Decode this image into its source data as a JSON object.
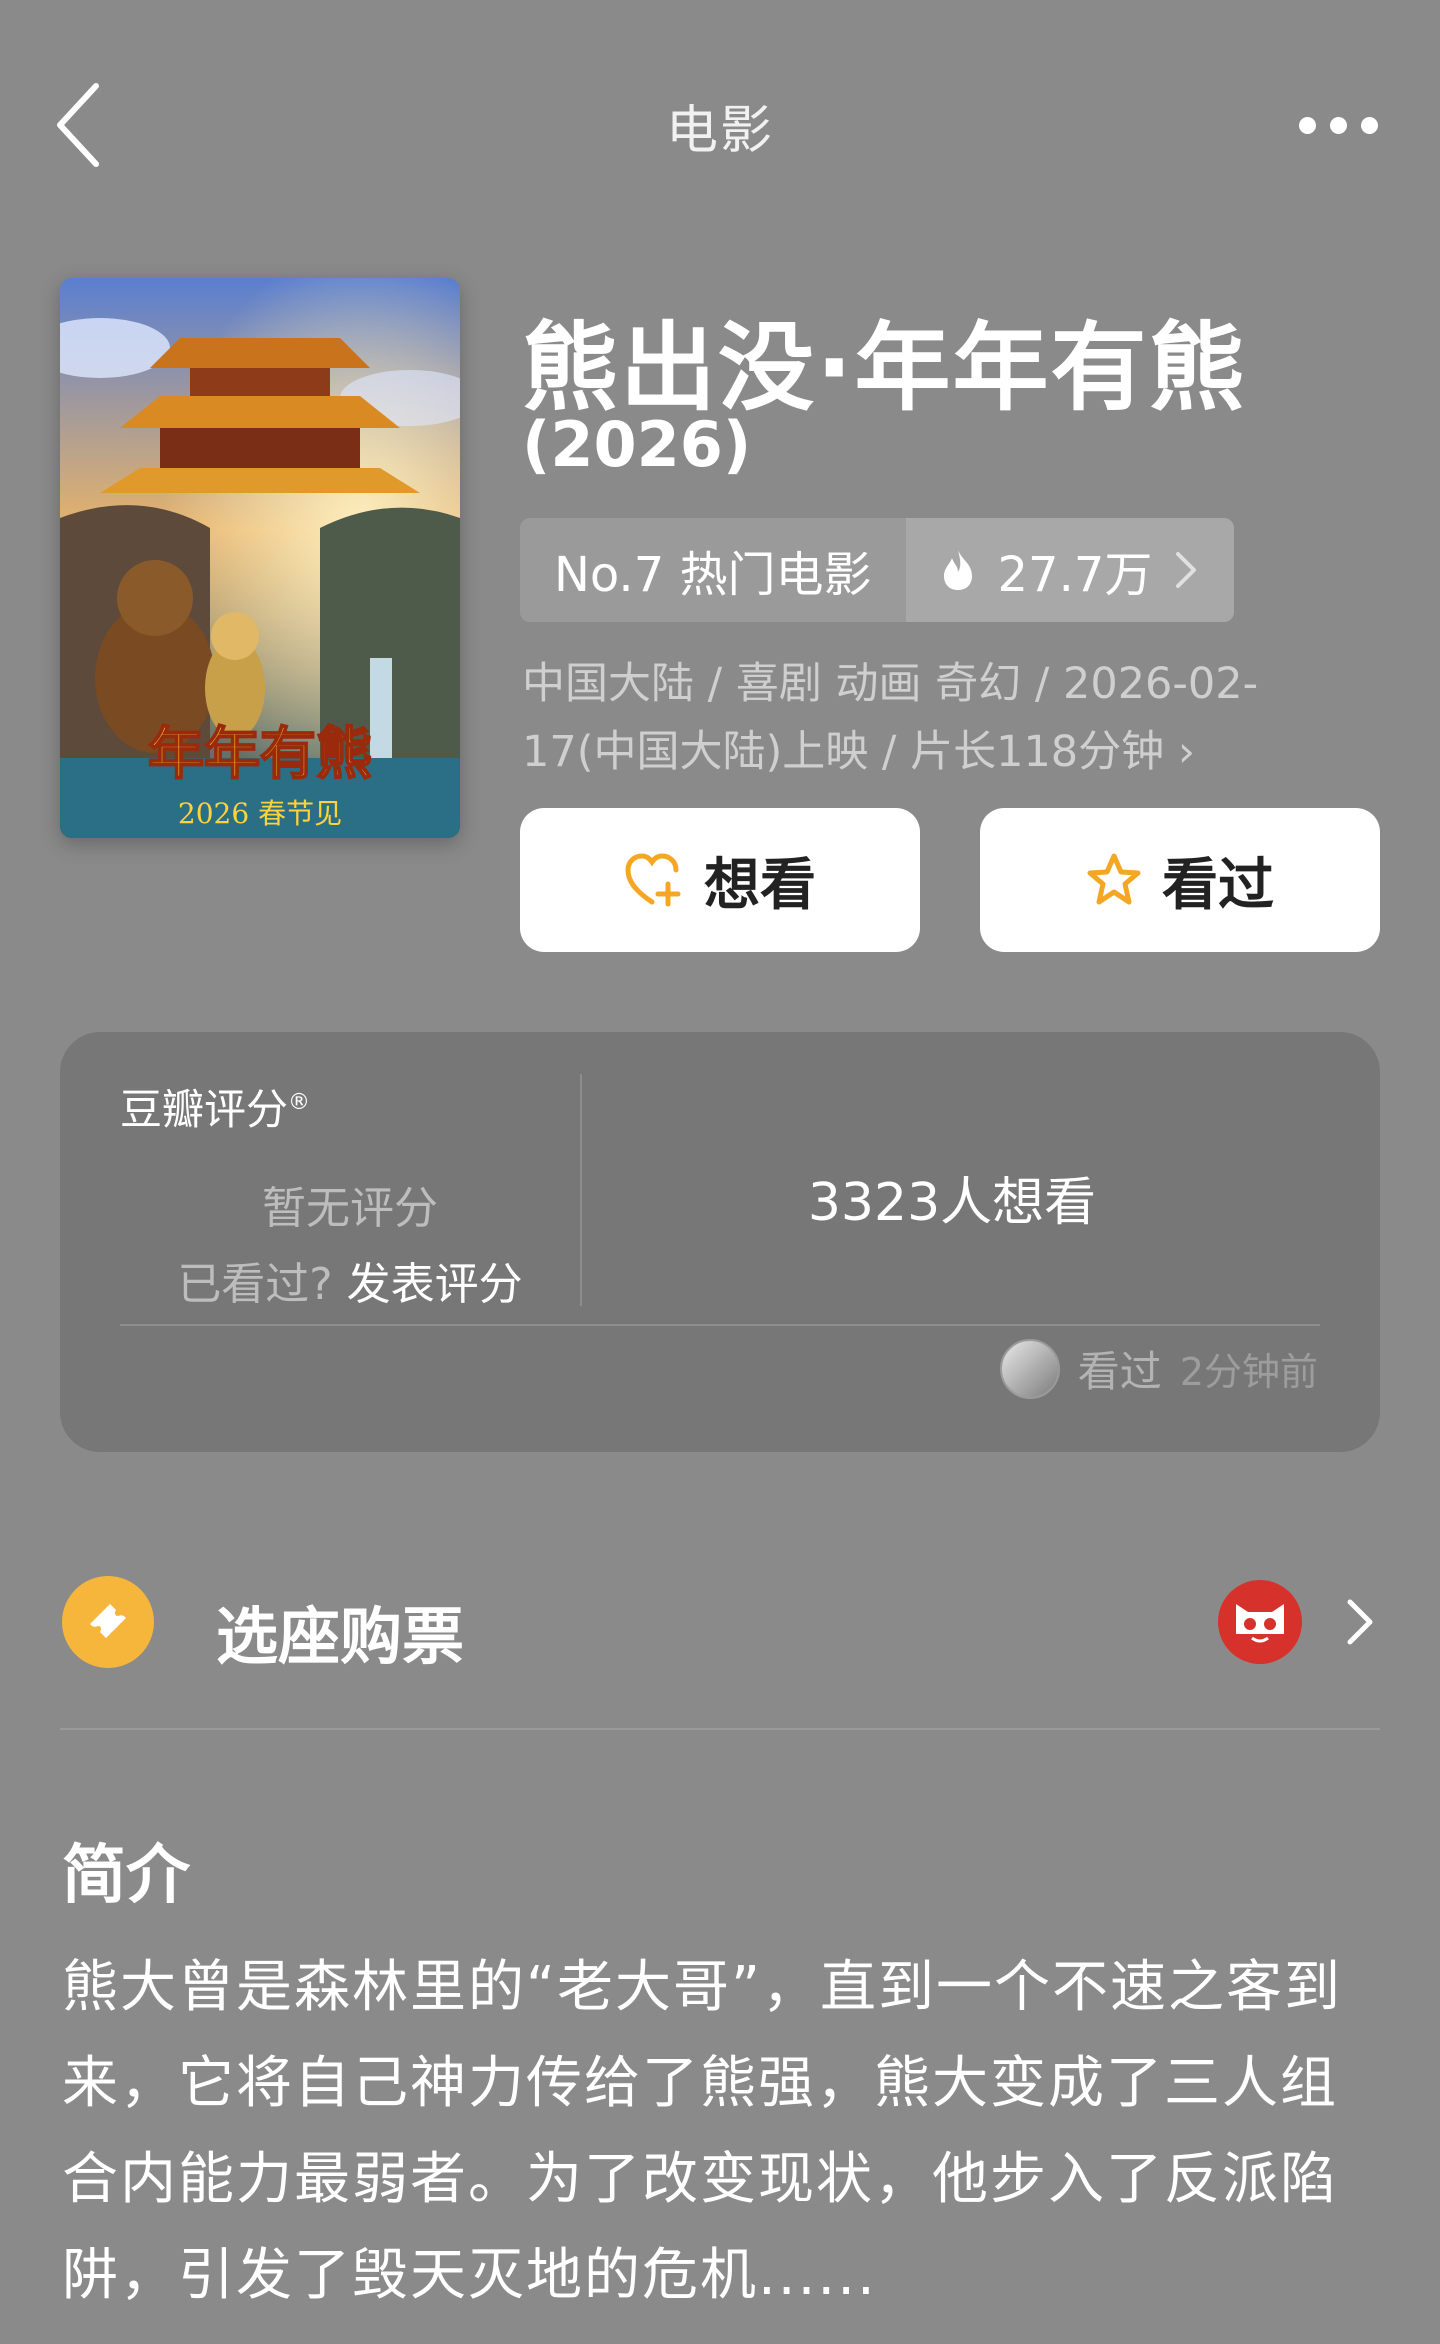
{
  "header": {
    "title": "电影"
  },
  "movie": {
    "title": "熊出没·年年有熊",
    "year": "(2026)",
    "rank_label": "No.7 热门电影",
    "heat": "27.7万",
    "meta": "中国大陆 / 喜剧 动画 奇幻 / 2026-02-17(中国大陆)上映 / 片长118分钟 ›",
    "poster_text": "年年有熊",
    "poster_subtext": "2026 春节见"
  },
  "actions": {
    "want_label": "想看",
    "seen_label": "看过"
  },
  "rating": {
    "label": "豆瓣评分",
    "label_mark": "®",
    "no_rating": "暂无评分",
    "seen_question": "已看过?",
    "post_rating": "发表评分",
    "want_count": "3323人想看",
    "activity_action": "看过",
    "activity_time": "2分钟前"
  },
  "ticket": {
    "label": "选座购票"
  },
  "synopsis": {
    "title": "简介",
    "text": "熊大曾是森林里的“老大哥”，直到一个不速之客到来，它将自己神力传给了熊强，熊大变成了三人组合内能力最弱者。为了改变现状，他步入了反派陷阱，引发了毁天灭地的危机......"
  },
  "colors": {
    "background": "#8a8a8a",
    "card": "#777777",
    "accent_orange": "#f5a623",
    "maoyan_red": "#d6312b"
  }
}
